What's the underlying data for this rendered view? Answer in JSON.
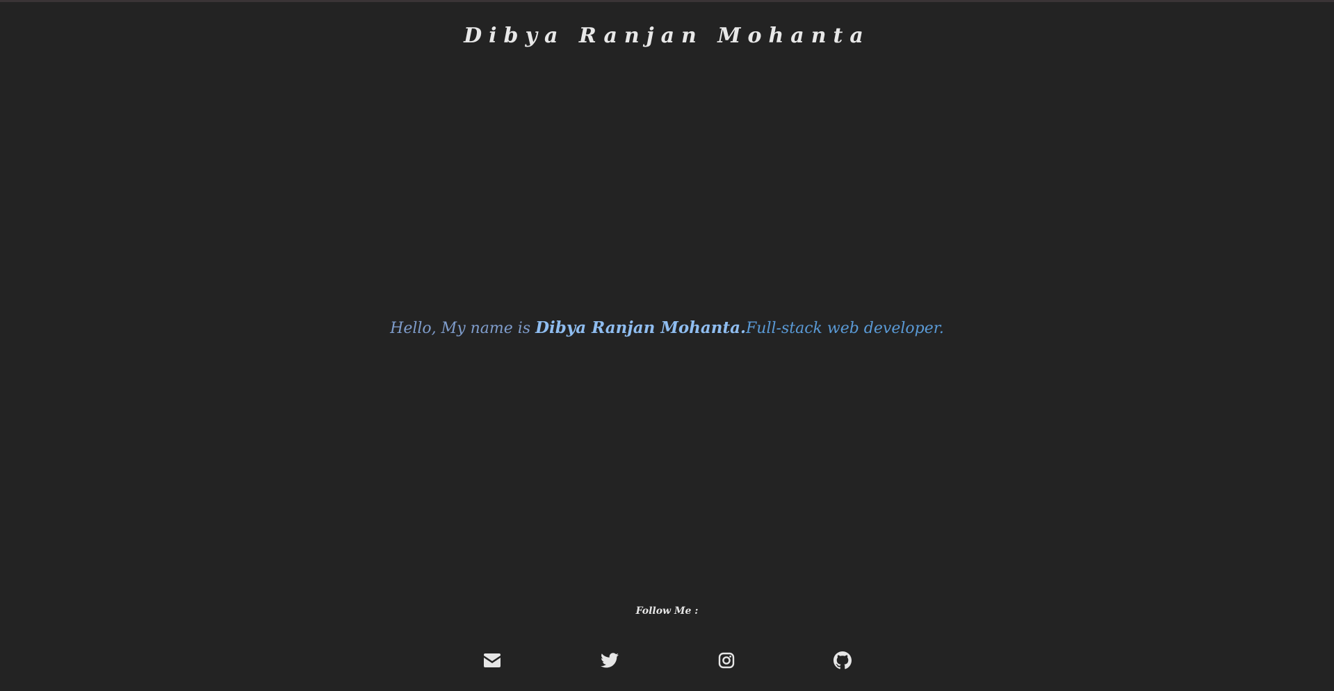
{
  "header": {
    "title": "Dibya Ranjan Mohanta"
  },
  "intro": {
    "greeting": "Hello, My name is ",
    "name": "Dibya Ranjan Mohanta.",
    "role": "Full-stack web developer."
  },
  "footer": {
    "follow_label": "Follow Me :",
    "social_icons": [
      "envelope-icon",
      "twitter-icon",
      "instagram-icon",
      "github-icon"
    ]
  },
  "colors": {
    "background": "#232323",
    "intro_text": "#6f9fd8",
    "title_text": "#e8e8e8",
    "icon": "#e6e6e6"
  }
}
